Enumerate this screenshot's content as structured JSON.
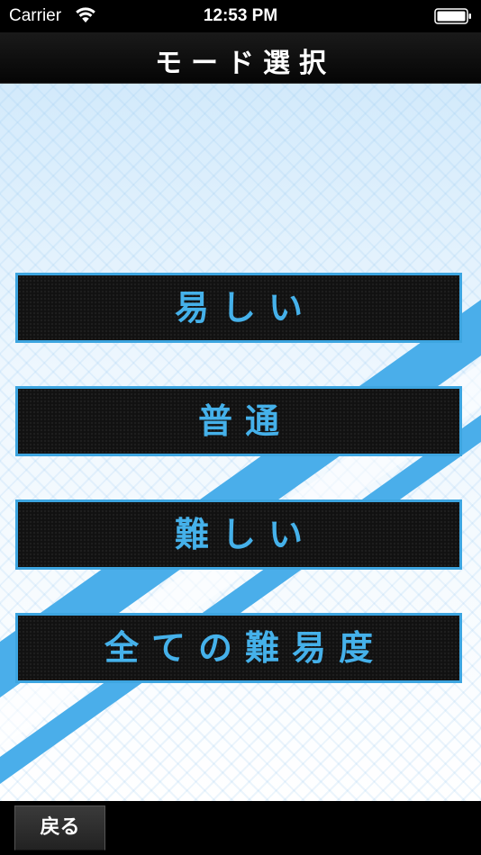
{
  "status_bar": {
    "carrier": "Carrier",
    "time": "12:53 PM",
    "wifi_icon": "wifi-icon",
    "battery_icon": "battery-icon"
  },
  "header": {
    "title": "モード選択"
  },
  "modes": [
    {
      "label": "易しい"
    },
    {
      "label": "普通"
    },
    {
      "label": "難しい"
    },
    {
      "label": "全ての難易度"
    }
  ],
  "footer": {
    "back_label": "戻る"
  },
  "colors": {
    "accent": "#45b1ea",
    "button_border": "#3da5e0",
    "stripe": "#4aaeea",
    "background": "#eaf5fd"
  }
}
